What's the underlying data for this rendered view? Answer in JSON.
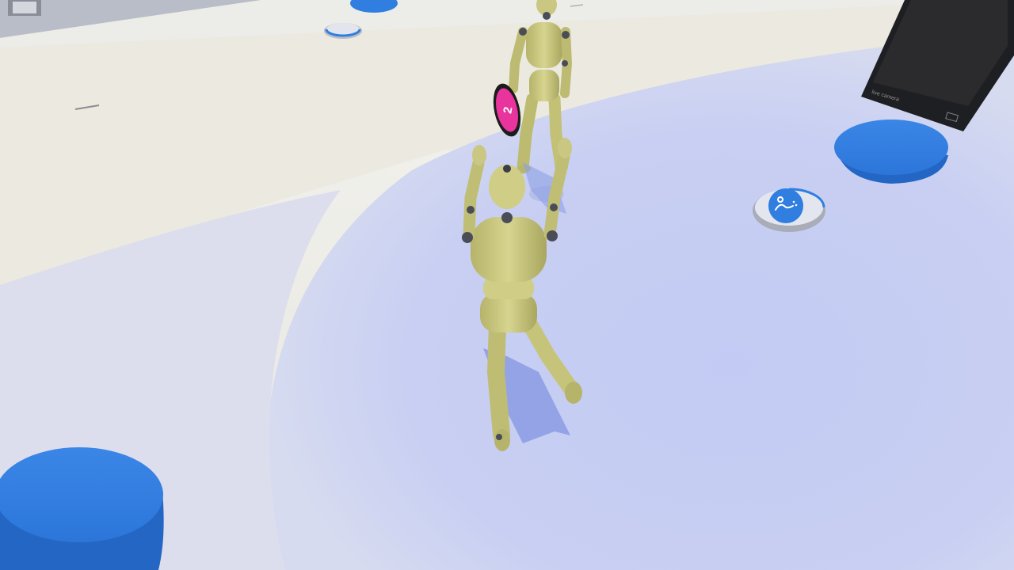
{
  "scene": {
    "type": "3d-game-view",
    "floor_color": "#c5cdf2",
    "pad_color": "#2f7ee0"
  },
  "frisbee": {
    "number": "2",
    "color": "#e8349c",
    "rim_color": "#1c1c1c"
  },
  "monitor": {
    "label": "live camera",
    "screen_color": "#2b2b2d"
  },
  "icons": {
    "spawn_marker": "person-lying-icon",
    "stand_marker": "person-standing-icon"
  },
  "characters": [
    {
      "name": "mannequin-thrower",
      "color": "#c8c57a"
    },
    {
      "name": "mannequin-catcher",
      "color": "#c8c57a"
    }
  ]
}
